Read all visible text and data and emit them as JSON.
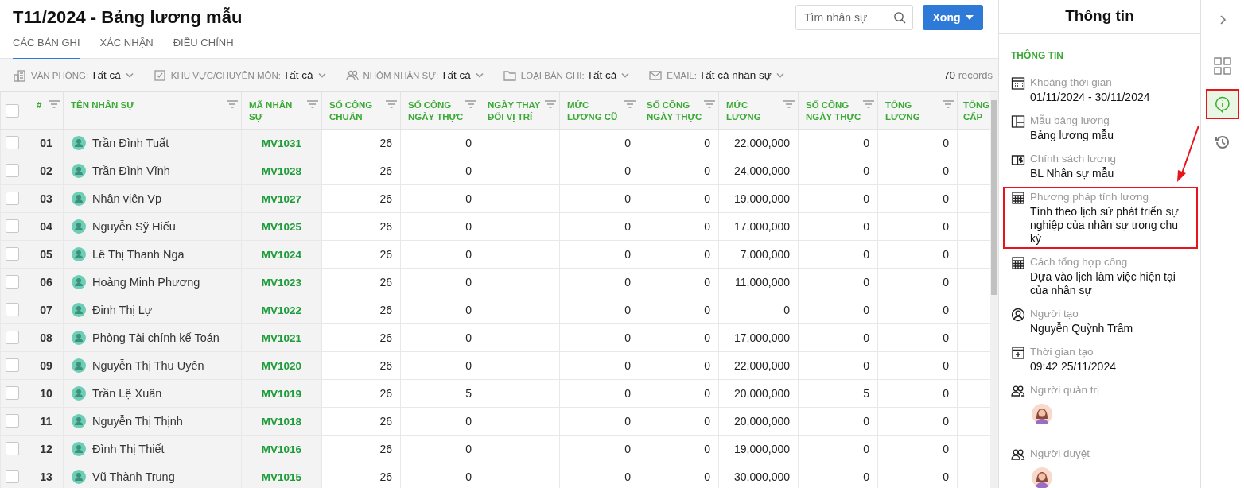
{
  "page": {
    "title": "T11/2024 - Bảng lương mẫu"
  },
  "tabs": [
    {
      "label": "CÁC BẢN GHI",
      "selected": true
    },
    {
      "label": "XÁC NHẬN",
      "selected": false
    },
    {
      "label": "ĐIỀU CHỈNH",
      "selected": false
    }
  ],
  "search": {
    "placeholder": "Tìm nhân sự"
  },
  "done_button": {
    "label": "Xong"
  },
  "filters": [
    {
      "kind": "office",
      "label": "VĂN PHÒNG:",
      "value": "Tất cả"
    },
    {
      "kind": "area",
      "label": "KHU VỰC/CHUYÊN MÔN:",
      "value": "Tất cả"
    },
    {
      "kind": "group",
      "label": "NHÓM NHÂN SỰ:",
      "value": "Tất cả"
    },
    {
      "kind": "type",
      "label": "LOẠI BẢN GHI:",
      "value": "Tất cả"
    },
    {
      "kind": "email",
      "label": "EMAIL:",
      "value": "Tất cả nhân sự"
    }
  ],
  "records": {
    "count": "70",
    "label": "records"
  },
  "table": {
    "select_all_checked": false,
    "columns": [
      {
        "label": "#"
      },
      {
        "label": "TÊN NHÂN SỰ"
      },
      {
        "label": "MÃ NHÂN SỰ"
      },
      {
        "label": "SỐ CÔNG CHUẨN"
      },
      {
        "label": "SỐ CÔNG NGÀY THỰC"
      },
      {
        "label": "NGÀY THAY ĐỔI VỊ TRÍ"
      },
      {
        "label": "MỨC LƯƠNG CŨ"
      },
      {
        "label": "SỐ CÔNG NGÀY THỰC"
      },
      {
        "label": "MỨC LƯƠNG"
      },
      {
        "label": "SỐ CÔNG NGÀY THỰC"
      },
      {
        "label": "TỔNG LƯƠNG"
      },
      {
        "label": "TỔNG CẤP"
      }
    ],
    "rows": [
      {
        "checked": false,
        "index": "01",
        "name": "Trần Đình Tuất",
        "code": "MV1031",
        "std_days": "26",
        "actual_days": "0",
        "old_salary": "0",
        "actual_days_2": "0",
        "salary": "22,000,000",
        "actual_days_3": "0",
        "total_salary": "0"
      },
      {
        "checked": false,
        "index": "02",
        "name": "Trần Đình Vĩnh",
        "code": "MV1028",
        "std_days": "26",
        "actual_days": "0",
        "old_salary": "0",
        "actual_days_2": "0",
        "salary": "24,000,000",
        "actual_days_3": "0",
        "total_salary": "0"
      },
      {
        "checked": false,
        "index": "03",
        "name": "Nhân viên Vp",
        "code": "MV1027",
        "std_days": "26",
        "actual_days": "0",
        "old_salary": "0",
        "actual_days_2": "0",
        "salary": "19,000,000",
        "actual_days_3": "0",
        "total_salary": "0"
      },
      {
        "checked": false,
        "index": "04",
        "name": "Nguyễn Sỹ Hiếu",
        "code": "MV1025",
        "std_days": "26",
        "actual_days": "0",
        "old_salary": "0",
        "actual_days_2": "0",
        "salary": "17,000,000",
        "actual_days_3": "0",
        "total_salary": "0"
      },
      {
        "checked": false,
        "index": "05",
        "name": "Lê Thị Thanh Nga",
        "code": "MV1024",
        "std_days": "26",
        "actual_days": "0",
        "old_salary": "0",
        "actual_days_2": "0",
        "salary": "7,000,000",
        "actual_days_3": "0",
        "total_salary": "0"
      },
      {
        "checked": false,
        "index": "06",
        "name": "Hoàng Minh Phương",
        "code": "MV1023",
        "std_days": "26",
        "actual_days": "0",
        "old_salary": "0",
        "actual_days_2": "0",
        "salary": "11,000,000",
        "actual_days_3": "0",
        "total_salary": "0"
      },
      {
        "checked": false,
        "index": "07",
        "name": "Đinh Thị Lự",
        "code": "MV1022",
        "std_days": "26",
        "actual_days": "0",
        "old_salary": "0",
        "actual_days_2": "0",
        "salary": "0",
        "actual_days_3": "0",
        "total_salary": "0"
      },
      {
        "checked": false,
        "index": "08",
        "name": "Phòng Tài chính kế Toán",
        "code": "MV1021",
        "std_days": "26",
        "actual_days": "0",
        "old_salary": "0",
        "actual_days_2": "0",
        "salary": "17,000,000",
        "actual_days_3": "0",
        "total_salary": "0"
      },
      {
        "checked": false,
        "index": "09",
        "name": "Nguyễn Thị Thu Uyên",
        "code": "MV1020",
        "std_days": "26",
        "actual_days": "0",
        "old_salary": "0",
        "actual_days_2": "0",
        "salary": "22,000,000",
        "actual_days_3": "0",
        "total_salary": "0"
      },
      {
        "checked": false,
        "index": "10",
        "name": "Trần Lệ Xuân",
        "code": "MV1019",
        "std_days": "26",
        "actual_days": "5",
        "old_salary": "0",
        "actual_days_2": "0",
        "salary": "20,000,000",
        "actual_days_3": "5",
        "total_salary": "0"
      },
      {
        "checked": false,
        "index": "11",
        "name": "Nguyễn Thị Thịnh",
        "code": "MV1018",
        "std_days": "26",
        "actual_days": "0",
        "old_salary": "0",
        "actual_days_2": "0",
        "salary": "20,000,000",
        "actual_days_3": "0",
        "total_salary": "0"
      },
      {
        "checked": false,
        "index": "12",
        "name": "Đình Thị Thiết",
        "code": "MV1016",
        "std_days": "26",
        "actual_days": "0",
        "old_salary": "0",
        "actual_days_2": "0",
        "salary": "19,000,000",
        "actual_days_3": "0",
        "total_salary": "0"
      },
      {
        "checked": false,
        "index": "13",
        "name": "Vũ Thành Trung",
        "code": "MV1015",
        "std_days": "26",
        "actual_days": "0",
        "old_salary": "0",
        "actual_days_2": "0",
        "salary": "30,000,000",
        "actual_days_3": "0",
        "total_salary": "0"
      }
    ]
  },
  "info_panel": {
    "title": "Thông tin",
    "section": "THÔNG TIN",
    "items": [
      {
        "kind": "calendar",
        "label": "Khoảng thời gian",
        "value": "01/11/2024 - 30/11/2024",
        "highlighted": false
      },
      {
        "kind": "template",
        "label": "Mẫu bảng lương",
        "value": "Bảng lương mẫu",
        "highlighted": false
      },
      {
        "kind": "policy",
        "label": "Chính sách lương",
        "value": "BL Nhân sự mẫu",
        "highlighted": false
      },
      {
        "kind": "calculator",
        "label": "Phương pháp tính lương",
        "value": "Tính theo lịch sử phát triển sự nghiệp của nhân sự trong chu kỳ",
        "highlighted": true
      },
      {
        "kind": "calculator",
        "label": "Cách tổng hợp công",
        "value": "Dựa vào lịch làm việc hiện tại của nhân sự",
        "highlighted": false
      },
      {
        "kind": "person",
        "label": "Người tạo",
        "value": "Nguyễn Quỳnh Trâm",
        "highlighted": false
      },
      {
        "kind": "calendar_add",
        "label": "Thời gian tạo",
        "value": "09:42 25/11/2024",
        "highlighted": false
      },
      {
        "kind": "people",
        "label": "Người quản trị",
        "highlighted": false
      },
      {
        "kind": "people",
        "label": "Người duyệt",
        "highlighted": false
      }
    ]
  },
  "rail": {
    "items": [
      {
        "kind": "collapse",
        "selected": false,
        "highlighted": false
      },
      {
        "kind": "grid",
        "selected": false,
        "highlighted": false
      },
      {
        "kind": "info",
        "selected": true,
        "highlighted": true
      },
      {
        "kind": "history",
        "selected": false,
        "highlighted": false
      }
    ]
  },
  "annotation_arrow": true
}
